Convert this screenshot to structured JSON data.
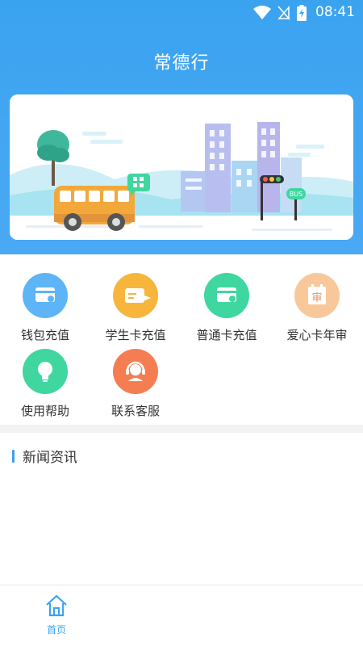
{
  "status_bar": {
    "time": "08:41"
  },
  "app": {
    "title": "常德行"
  },
  "banner": {
    "bus_sign": "BUS"
  },
  "functions": [
    {
      "label": "钱包充值",
      "icon": "wallet-card-icon",
      "color": "#5db5f7"
    },
    {
      "label": "学生卡充值",
      "icon": "student-card-icon",
      "color": "#f7b53c"
    },
    {
      "label": "普通卡充值",
      "icon": "normal-card-icon",
      "color": "#3fd6a0"
    },
    {
      "label": "爱心卡年审",
      "icon": "review-icon",
      "color": "#f8c89a",
      "badge": "审"
    },
    {
      "label": "使用帮助",
      "icon": "lightbulb-icon",
      "color": "#3fd6a0"
    },
    {
      "label": "联系客服",
      "icon": "headset-icon",
      "color": "#f57d52"
    }
  ],
  "news": {
    "title": "新闻资讯"
  },
  "tabbar": {
    "home_label": "首页"
  },
  "colors": {
    "primary": "#3aa3f0"
  }
}
